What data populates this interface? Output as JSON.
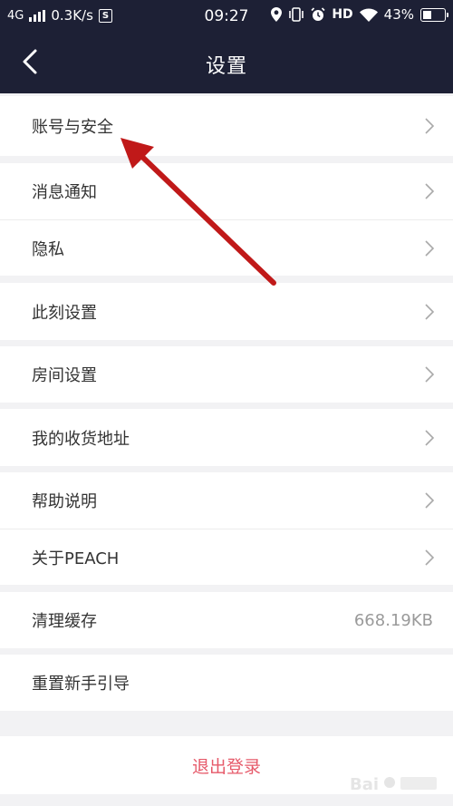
{
  "status_bar": {
    "network": "4G",
    "speed": "0.3K/s",
    "s_icon": "S",
    "time": "09:27",
    "hd": "HD",
    "battery": "43%",
    "battery_level": 0.43
  },
  "header": {
    "title": "设置"
  },
  "menu": {
    "account_security": "账号与安全",
    "notifications": "消息通知",
    "privacy": "隐私",
    "moment_settings": "此刻设置",
    "room_settings": "房间设置",
    "shipping_address": "我的收货地址",
    "help": "帮助说明",
    "about": "关于PEACH",
    "clear_cache": "清理缓存",
    "clear_cache_value": "668.19KB",
    "reset_guide": "重置新手引导"
  },
  "logout_label": "退出登录",
  "colors": {
    "header_bg": "#1d2035",
    "logout_text": "#e65a6a",
    "annotation_arrow": "#c01919"
  },
  "icons": [
    "back-chevron-icon",
    "location-icon",
    "vibrate-icon",
    "alarm-icon",
    "wifi-icon",
    "battery-icon",
    "chevron-right-icon"
  ]
}
